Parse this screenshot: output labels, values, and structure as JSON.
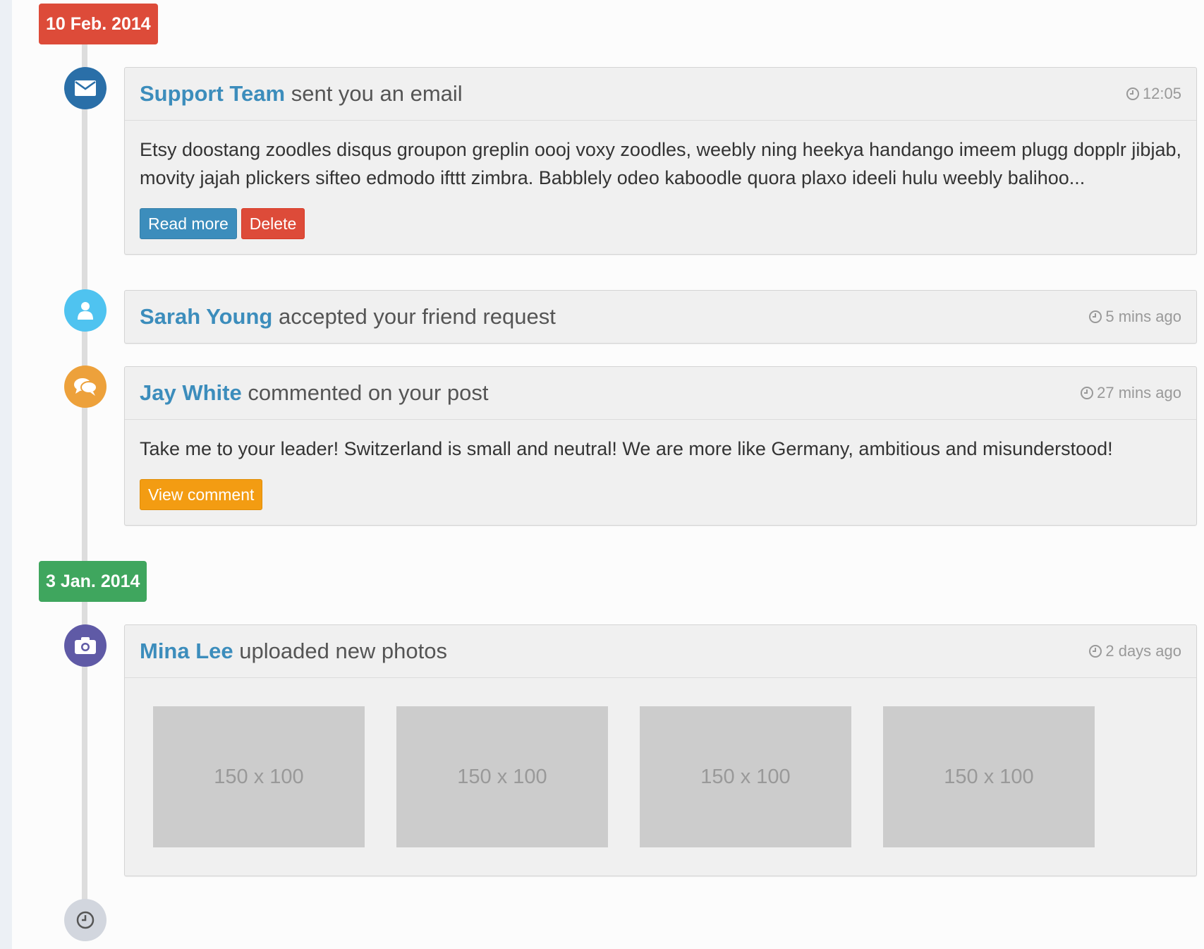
{
  "timeline": {
    "dates": [
      {
        "label": "10 Feb. 2014",
        "color": "#dd4b39"
      },
      {
        "label": "3 Jan. 2014",
        "color": "#00a65a"
      }
    ],
    "items": [
      {
        "icon": "envelope-icon",
        "icon_color": "#0073b7",
        "actor": "Support Team",
        "action": " sent you an email",
        "time": "12:05",
        "body": "Etsy doostang zoodles disqus groupon greplin oooj voxy zoodles, weebly ning heekya handango imeem plugg dopplr jibjab, movity jajah plickers sifteo edmodo ifttt zimbra. Babblely odeo kaboodle quora plaxo ideeli hulu weebly balihoo...",
        "buttons": [
          {
            "label": "Read more",
            "color": "#3c8dbc"
          },
          {
            "label": "Delete",
            "color": "#dd4b39"
          }
        ]
      },
      {
        "icon": "user-icon",
        "icon_color": "#00c0ef",
        "actor": "Sarah Young",
        "action": " accepted your friend request",
        "time": "5 mins ago"
      },
      {
        "icon": "comments-icon",
        "icon_color": "#f39c12",
        "actor": "Jay White",
        "action": " commented on your post",
        "time": "27 mins ago",
        "body": "Take me to your leader! Switzerland is small and neutral! We are more like Germany, ambitious and misunderstood!",
        "buttons": [
          {
            "label": "View comment",
            "color": "#f39c12"
          }
        ]
      },
      {
        "icon": "camera-icon",
        "icon_color": "#605ca8",
        "actor": "Mina Lee",
        "action": " uploaded new photos",
        "time": "2 days ago",
        "photos": [
          "150 x 100",
          "150 x 100",
          "150 x 100",
          "150 x 100"
        ]
      }
    ],
    "end_icon": "clock-icon",
    "end_icon_color": "#d2d6de"
  }
}
